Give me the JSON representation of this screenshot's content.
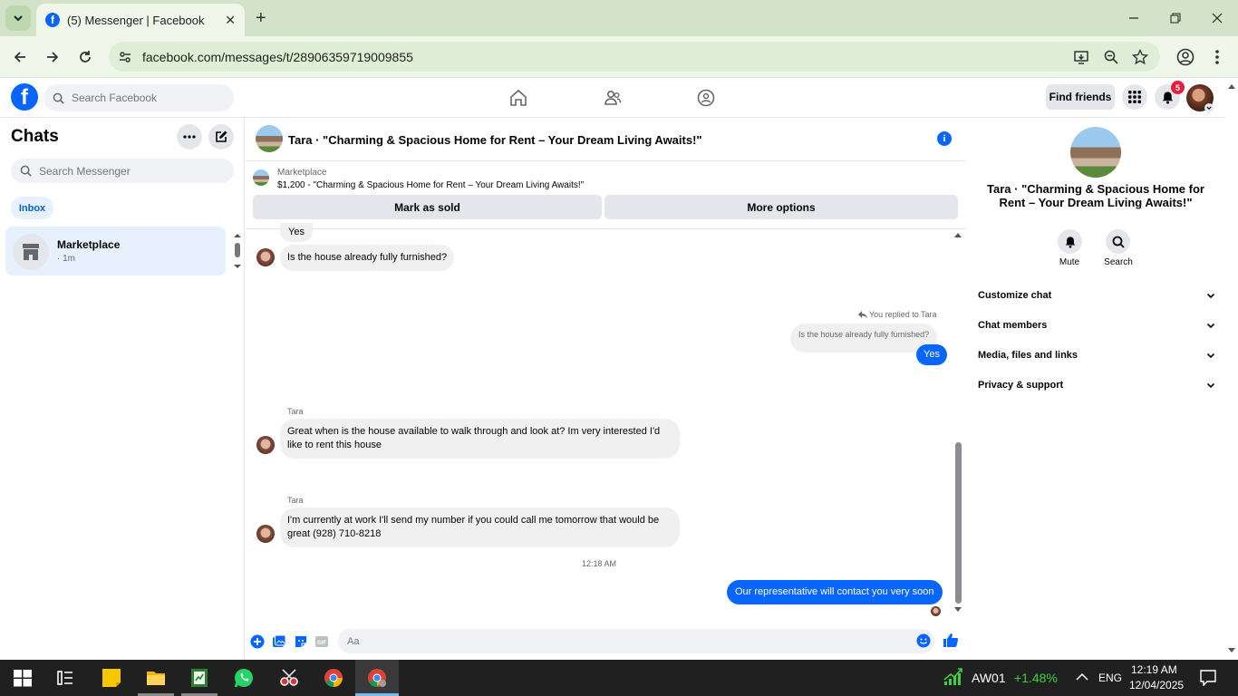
{
  "browser": {
    "tab_title": "(5) Messenger | Facebook",
    "url": "facebook.com/messages/t/28906359719009855"
  },
  "fb": {
    "search_placeholder": "Search Facebook",
    "find_friends": "Find friends",
    "notification_count": "5"
  },
  "left": {
    "title": "Chats",
    "search_placeholder": "Search Messenger",
    "inbox_label": "Inbox",
    "conversations": [
      {
        "name": "Marketplace",
        "time": "· 1m"
      }
    ]
  },
  "chat": {
    "header_title": "Tara · \"Charming & Spacious Home for Rent – Your Dream Living Awaits!\"",
    "marketplace_label": "Marketplace",
    "listing": "$1,200 - \"Charming & Spacious Home for Rent – Your Dream Living Awaits!\"",
    "mark_sold": "Mark as sold",
    "more_options": "More options",
    "messages": {
      "m1": "Yes",
      "m2": "Is the house already fully furnished?",
      "reply_label": "You replied to Tara",
      "quoted": "Is the house already fully furnished?",
      "m3": "Yes",
      "sender": "Tara",
      "m4": "Great when is the house available to walk through and look at? Im very interested I'd like to rent this house",
      "m5": "I'm currently at work I'll send my number if you could call me tomorrow that would be great (928) 710-8218",
      "timestamp": "12:18 AM",
      "m6": "Our representative will contact you very soon"
    },
    "input_placeholder": "Aa"
  },
  "right": {
    "name": "Tara · \"Charming & Spacious Home for Rent – Your Dream Living Awaits!\"",
    "mute": "Mute",
    "search": "Search",
    "sections": [
      "Customize chat",
      "Chat members",
      "Media, files and links",
      "Privacy & support"
    ]
  },
  "taskbar": {
    "stock_name": "AW01",
    "stock_change": "+1.48%",
    "lang": "ENG",
    "time": "12:19 AM",
    "date": "12/04/2025"
  },
  "colors": {
    "accent": "#0866ff",
    "chrome_tab": "#d3e3c9",
    "stock_green": "#3fd13f"
  }
}
